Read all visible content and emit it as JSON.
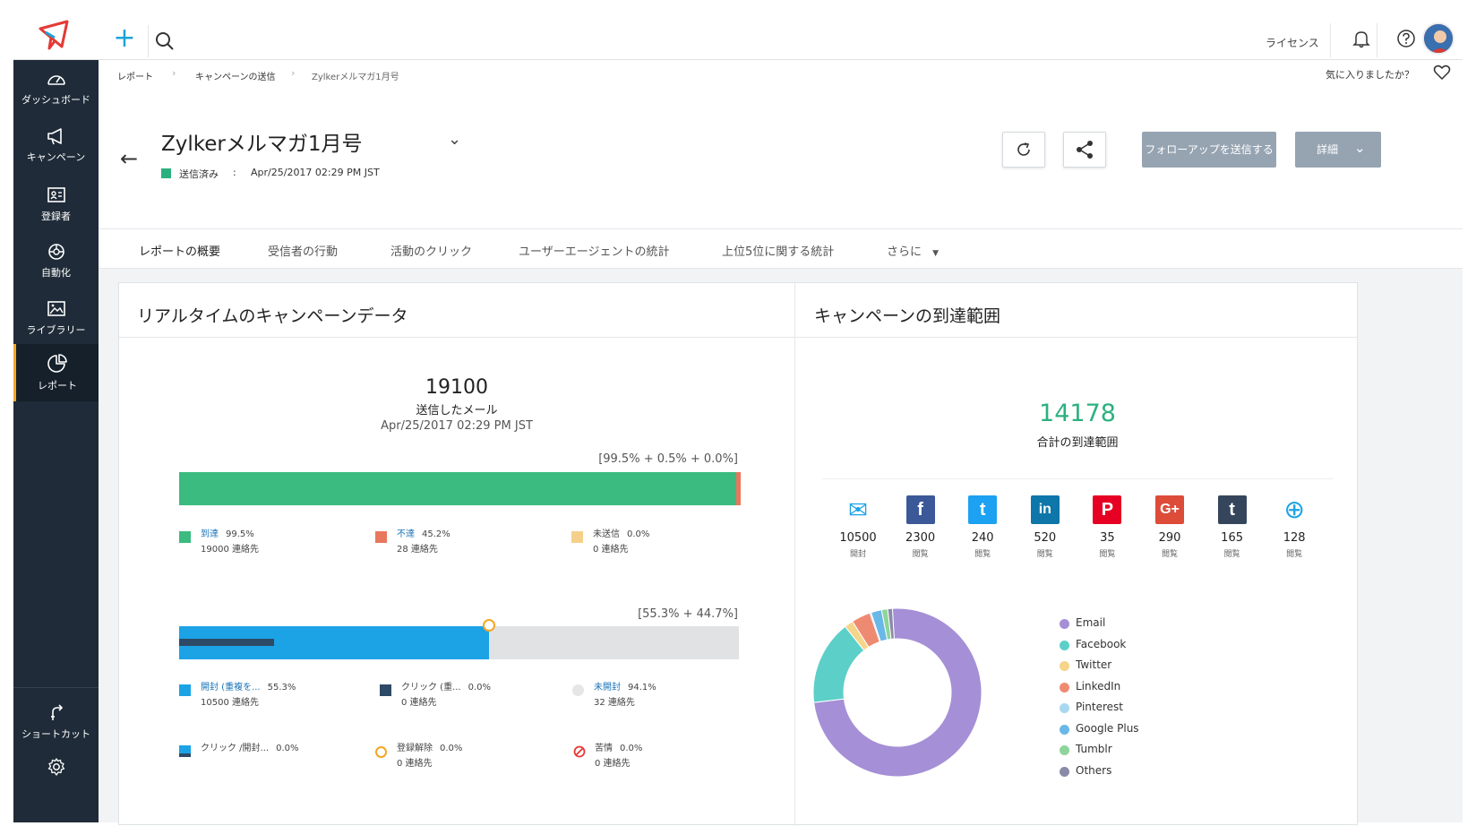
{
  "topbar": {
    "plus_label": "+",
    "license_label": "ライセンス"
  },
  "sidebar": {
    "items": [
      {
        "label": "ダッシュボード",
        "icon": "dashboard-icon"
      },
      {
        "label": "キャンペーン",
        "icon": "megaphone-icon"
      },
      {
        "label": "登録者",
        "icon": "contacts-icon"
      },
      {
        "label": "自動化",
        "icon": "automation-icon"
      },
      {
        "label": "ライブラリー",
        "icon": "library-icon"
      },
      {
        "label": "レポート",
        "icon": "report-icon"
      }
    ],
    "shortcut_label": "ショートカット",
    "active_item": "レポート"
  },
  "breadcrumb": {
    "items": [
      "レポート",
      "キャンペーンの送信",
      "Zylkerメルマガ1月号"
    ],
    "favorite_label": "気に入りましたか？"
  },
  "header": {
    "title": "Zylkerメルマガ1月号",
    "status": "送信済み",
    "separator": ":",
    "date": "Apr/25/2017 02:29 PM JST",
    "follow_up_button": "フォローアップを送信する",
    "detail_button": "詳細"
  },
  "tabs": [
    "レポートの概要",
    "受信者の行動",
    "活動のクリック",
    "ユーザーエージェントの統計",
    "上位5位に関する統計",
    "さらに"
  ],
  "realtime": {
    "title": "リアルタイムのキャンペーンデータ",
    "sent_count": "19100",
    "sent_label": "送信したメール",
    "sent_date": "Apr/25/2017 02:29 PM JST",
    "delivery_bar": {
      "label": "[99.5% + 0.5% + 0.0%]",
      "segments": [
        {
          "name": "delivered",
          "pct": 99.5,
          "color": "#3bbb80"
        },
        {
          "name": "bounced",
          "pct": 0.5,
          "color": "#e8775e"
        },
        {
          "name": "not_sent",
          "pct": 0.0,
          "color": "#f5d08a"
        }
      ]
    },
    "delivery_legend": [
      {
        "name": "到達",
        "pct": "99.5%",
        "contacts": "19000 連絡先",
        "color": "#3bbb80",
        "link": true
      },
      {
        "name": "不達",
        "pct": "45.2%",
        "contacts": "28 連絡先",
        "color": "#e8775e",
        "link": true
      },
      {
        "name": "未送信",
        "pct": "0.0%",
        "contacts": "0 連絡先",
        "color": "#f5d08a",
        "link": false
      }
    ],
    "open_bar": {
      "label": "[55.3% + 44.7%]",
      "opened_pct": 55.3,
      "clicked_pct": 17.0,
      "colors": {
        "opened": "#1ba3e6",
        "clicked": "#2d4a66",
        "unopened": "#e0e2e4",
        "marker": "#f5a623"
      }
    },
    "open_legend": [
      {
        "name": "開封 (重複を...",
        "pct": "55.3%",
        "contacts": "10500 連絡先",
        "color": "#1ba3e6",
        "link": true
      },
      {
        "name": "クリック (重...",
        "pct": "0.0%",
        "contacts": "0 連絡先",
        "color": "#2d4a66",
        "link": false
      },
      {
        "name": "未開封",
        "pct": "94.1%",
        "contacts": "32 連絡先",
        "color": "#e6e6e6",
        "link": true
      }
    ],
    "extra_legend": [
      {
        "name": "クリック /開封...",
        "pct": "0.0%",
        "contacts": "",
        "icon": "click-open-icon"
      },
      {
        "name": "登録解除",
        "pct": "0.0%",
        "contacts": "0 連絡先",
        "icon": "unsubscribe-icon"
      },
      {
        "name": "苦情",
        "pct": "0.0%",
        "contacts": "0 連絡先",
        "icon": "complaint-icon"
      }
    ]
  },
  "reach": {
    "title": "キャンペーンの到達範囲",
    "total": "14178",
    "total_label": "合計の到達範囲",
    "channels": [
      {
        "name": "Email",
        "value": "10500",
        "unit": "開封",
        "icon": "email-icon",
        "color": "#1ba3e6"
      },
      {
        "name": "Facebook",
        "value": "2300",
        "unit": "閲覧",
        "icon": "facebook-icon",
        "color": "#3b5998"
      },
      {
        "name": "Twitter",
        "value": "240",
        "unit": "閲覧",
        "icon": "twitter-icon",
        "color": "#1da1f2"
      },
      {
        "name": "LinkedIn",
        "value": "520",
        "unit": "閲覧",
        "icon": "linkedin-icon",
        "color": "#0e76a8"
      },
      {
        "name": "Pinterest",
        "value": "35",
        "unit": "閲覧",
        "icon": "pinterest-icon",
        "color": "#e60023"
      },
      {
        "name": "Google Plus",
        "value": "290",
        "unit": "閲覧",
        "icon": "google-plus-icon",
        "color": "#dd4b39"
      },
      {
        "name": "Tumblr",
        "value": "165",
        "unit": "閲覧",
        "icon": "tumblr-icon",
        "color": "#35465c"
      },
      {
        "name": "Others",
        "value": "128",
        "unit": "閲覧",
        "icon": "globe-icon",
        "color": "#1ba3e6"
      }
    ]
  },
  "chart_data": {
    "type": "pie",
    "donut": true,
    "categories": [
      "Email",
      "Facebook",
      "Twitter",
      "LinkedIn",
      "Pinterest",
      "Google Plus",
      "Tumblr",
      "Others"
    ],
    "values": [
      10500,
      2300,
      240,
      520,
      35,
      290,
      165,
      128
    ],
    "colors": [
      "#a58fd6",
      "#5ccfc8",
      "#f5d58a",
      "#ef8a72",
      "#a8d8f0",
      "#6ab8e8",
      "#8fd49a",
      "#8a8aa8"
    ],
    "legend_position": "right"
  }
}
